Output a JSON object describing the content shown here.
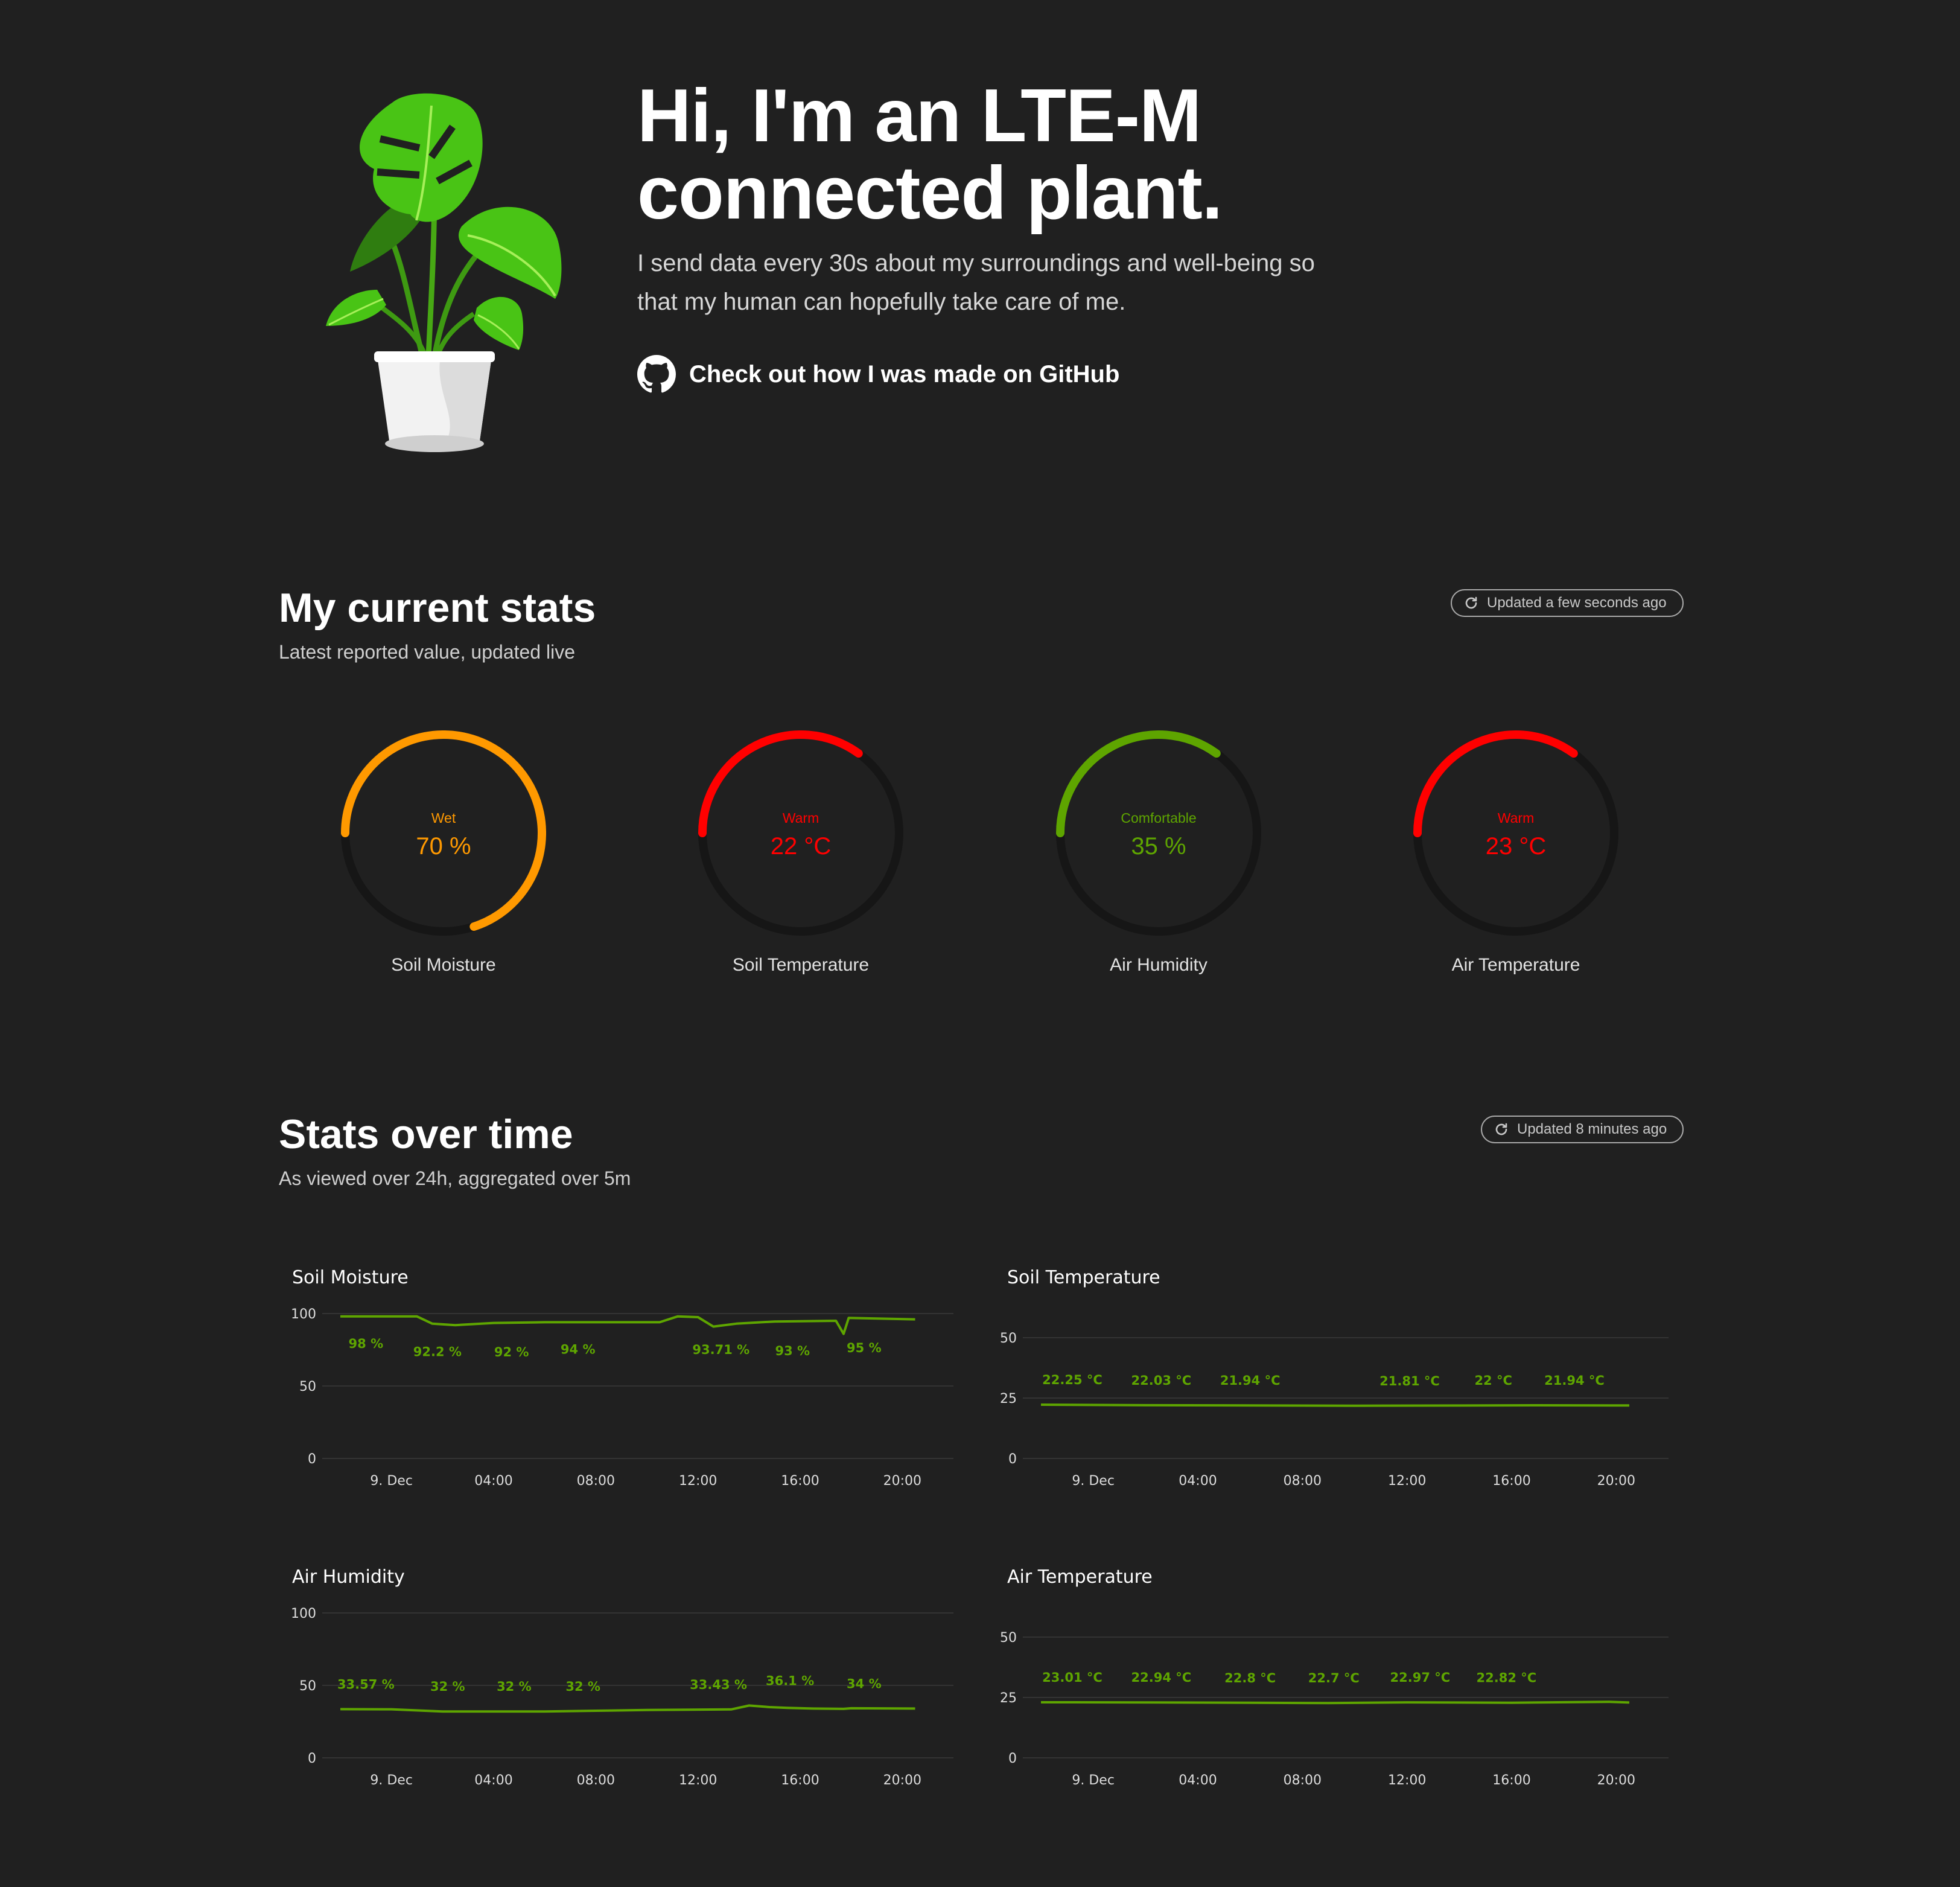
{
  "hero": {
    "title_line1": "Hi, I'm an LTE-M",
    "title_line2": "connected plant.",
    "subtitle": "I send data every 30s about my surroundings and well-being so that my human can hopefully take care of me.",
    "github_link": "Check out how I was made on GitHub",
    "github_icon": "github-icon",
    "plant_image": "potted-monstera-plant"
  },
  "current": {
    "title": "My current stats",
    "subtitle": "Latest reported value, updated live",
    "updated": "Updated a few seconds ago",
    "refresh_icon": "refresh-icon",
    "gauges": [
      {
        "label": "Soil Moisture",
        "state": "Wet",
        "value": "70 %",
        "fraction": 0.7,
        "color": "#ff9900"
      },
      {
        "label": "Soil Temperature",
        "state": "Warm",
        "value": "22 °C",
        "fraction": 0.35,
        "color": "#ff0000"
      },
      {
        "label": "Air Humidity",
        "state": "Comfortable",
        "value": "35 %",
        "fraction": 0.35,
        "color": "#5ea500"
      },
      {
        "label": "Air Temperature",
        "state": "Warm",
        "value": "23 °C",
        "fraction": 0.35,
        "color": "#ff0000"
      }
    ]
  },
  "history": {
    "title": "Stats over time",
    "subtitle": "As viewed over 24h, aggregated over 5m",
    "updated": "Updated 8 minutes ago",
    "refresh_icon": "refresh-icon",
    "line_color": "#5ea500",
    "grid_color": "#333333"
  },
  "chart_data": [
    {
      "type": "line",
      "title": "Soil Moisture",
      "ylim": [
        0,
        100
      ],
      "yticks": [
        "0",
        "50",
        "100"
      ],
      "xticks": [
        "9. Dec",
        "04:00",
        "08:00",
        "12:00",
        "16:00",
        "20:00"
      ],
      "x": [
        0,
        3,
        3.6,
        4.5,
        6,
        8,
        12.5,
        13.2,
        14,
        14.6,
        15.5,
        17,
        19.4,
        19.7,
        19.9,
        22.5
      ],
      "y": [
        98,
        98,
        93,
        92,
        93.5,
        94,
        94,
        98,
        97.5,
        91,
        93,
        94.5,
        95,
        86,
        97,
        96
      ],
      "labels": [
        {
          "x": 1,
          "y": 98,
          "text": "98 %"
        },
        {
          "x": 3.8,
          "y": 92.2,
          "text": "92.2 %"
        },
        {
          "x": 6.7,
          "y": 92,
          "text": "92 %"
        },
        {
          "x": 9.3,
          "y": 94,
          "text": "94 %"
        },
        {
          "x": 14.9,
          "y": 93.71,
          "text": "93.71 %"
        },
        {
          "x": 17.7,
          "y": 93,
          "text": "93 %"
        },
        {
          "x": 20.5,
          "y": 95,
          "text": "95 %"
        }
      ]
    },
    {
      "type": "line",
      "title": "Soil Temperature",
      "ylim": [
        0,
        50
      ],
      "yticks": [
        "0",
        "25",
        "50"
      ],
      "xticks": [
        "9. Dec",
        "04:00",
        "08:00",
        "12:00",
        "16:00",
        "20:00"
      ],
      "x": [
        0,
        4,
        8,
        12,
        16,
        19,
        22.5
      ],
      "y": [
        22.25,
        22.03,
        21.94,
        21.81,
        21.9,
        22,
        21.94
      ],
      "labels": [
        {
          "x": 1.2,
          "y": 22.25,
          "text": "22.25 °C"
        },
        {
          "x": 4.6,
          "y": 22.03,
          "text": "22.03 °C"
        },
        {
          "x": 8,
          "y": 21.94,
          "text": "21.94 °C"
        },
        {
          "x": 14.1,
          "y": 21.81,
          "text": "21.81 °C"
        },
        {
          "x": 17.3,
          "y": 22,
          "text": "22 °C"
        },
        {
          "x": 20.4,
          "y": 21.94,
          "text": "21.94 °C"
        }
      ]
    },
    {
      "type": "line",
      "title": "Air Humidity",
      "ylim": [
        0,
        100
      ],
      "yticks": [
        "0",
        "50",
        "100"
      ],
      "xticks": [
        "9. Dec",
        "04:00",
        "08:00",
        "12:00",
        "16:00",
        "20:00"
      ],
      "x": [
        0,
        2,
        4,
        8,
        10,
        12,
        15.3,
        16,
        16.8,
        17.5,
        18.5,
        19.7,
        20,
        22.5
      ],
      "y": [
        33.57,
        33.5,
        32,
        32,
        32.5,
        33,
        33.43,
        36.1,
        35,
        34.5,
        34,
        33.8,
        34.2,
        34
      ],
      "labels": [
        {
          "x": 1,
          "y": 33.57,
          "text": "33.57 %"
        },
        {
          "x": 4.2,
          "y": 32,
          "text": "32 %"
        },
        {
          "x": 6.8,
          "y": 32,
          "text": "32 %"
        },
        {
          "x": 9.5,
          "y": 32,
          "text": "32 %"
        },
        {
          "x": 14.8,
          "y": 33.43,
          "text": "33.43 %"
        },
        {
          "x": 17.6,
          "y": 36.1,
          "text": "36.1 %"
        },
        {
          "x": 20.5,
          "y": 34,
          "text": "34 %"
        }
      ]
    },
    {
      "type": "line",
      "title": "Air Temperature",
      "ylim": [
        0,
        50
      ],
      "yticks": [
        "0",
        "25",
        "50"
      ],
      "xticks": [
        "9. Dec",
        "04:00",
        "08:00",
        "12:00",
        "16:00",
        "20:00"
      ],
      "x": [
        0,
        4,
        8,
        11,
        14,
        18,
        21.7,
        22.5
      ],
      "y": [
        23.01,
        22.94,
        22.8,
        22.7,
        22.97,
        22.82,
        23.2,
        22.9
      ],
      "labels": [
        {
          "x": 1.2,
          "y": 23.01,
          "text": "23.01 °C"
        },
        {
          "x": 4.6,
          "y": 22.94,
          "text": "22.94 °C"
        },
        {
          "x": 8,
          "y": 22.8,
          "text": "22.8 °C"
        },
        {
          "x": 11.2,
          "y": 22.7,
          "text": "22.7 °C"
        },
        {
          "x": 14.5,
          "y": 22.97,
          "text": "22.97 °C"
        },
        {
          "x": 17.8,
          "y": 22.82,
          "text": "22.82 °C"
        }
      ]
    }
  ]
}
